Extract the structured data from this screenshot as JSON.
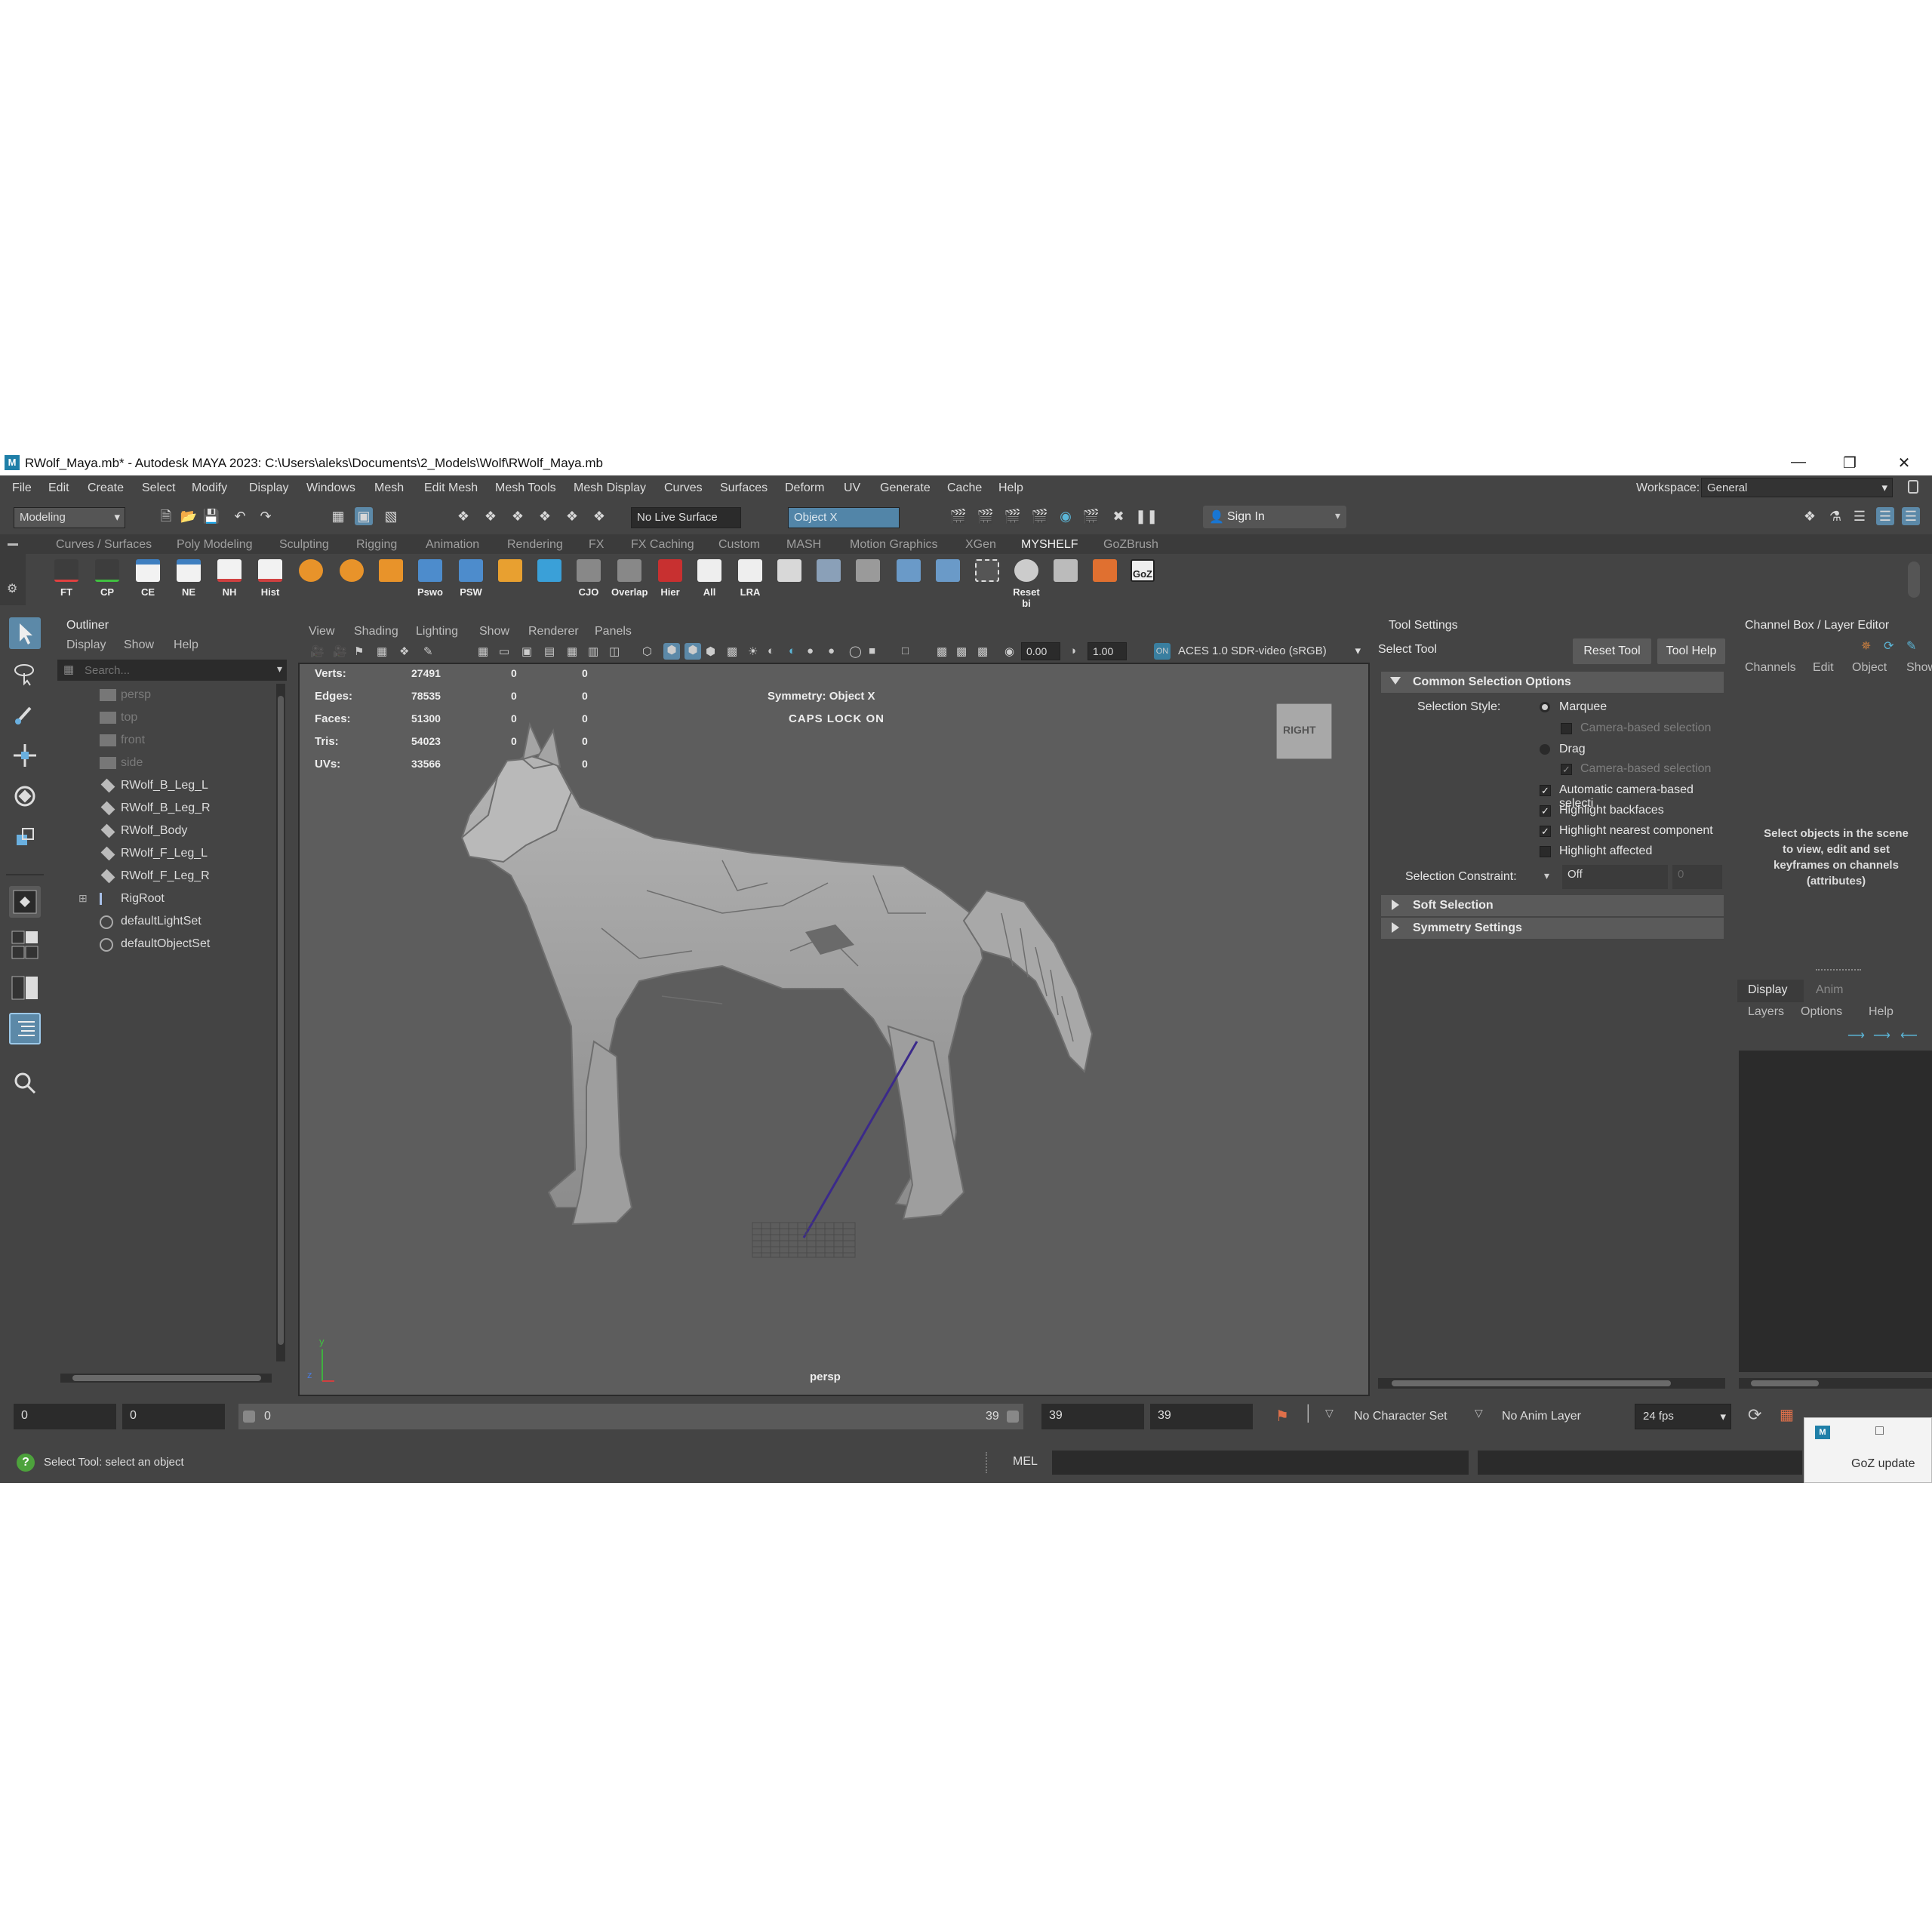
{
  "titlebar": {
    "title": "RWolf_Maya.mb* - Autodesk MAYA 2023: C:\\Users\\aleks\\Documents\\2_Models\\Wolf\\RWolf_Maya.mb",
    "app_icon": "M"
  },
  "menubar": {
    "items": [
      "File",
      "Edit",
      "Create",
      "Select",
      "Modify",
      "Display",
      "Windows",
      "Mesh",
      "Edit Mesh",
      "Mesh Tools",
      "Mesh Display",
      "Curves",
      "Surfaces",
      "Deform",
      "UV",
      "Generate",
      "Cache",
      "Help"
    ],
    "workspace_label": "Workspace:",
    "workspace_value": "General"
  },
  "statusline": {
    "menuset": "Modeling",
    "live_surface": "No Live Surface",
    "symmetry": "Object X",
    "sign_in": "Sign In"
  },
  "shelf": {
    "tabs": [
      "Curves / Surfaces",
      "Poly Modeling",
      "Sculpting",
      "Rigging",
      "Animation",
      "Rendering",
      "FX",
      "FX Caching",
      "Custom",
      "MASH",
      "Motion Graphics",
      "XGen",
      "MYSHELF",
      "GoZBrush"
    ],
    "active_tab": "MYSHELF",
    "buttons": [
      "FT",
      "CP",
      "CE",
      "NE",
      "NH",
      "Hist",
      "",
      "",
      "",
      "Pswo",
      "PSW",
      "",
      "",
      "CJO",
      "Overlap",
      "Hier",
      "All",
      "LRA",
      "",
      "",
      "",
      "",
      "",
      "",
      "",
      "Reset bi",
      "",
      "",
      "GoZ"
    ]
  },
  "outliner": {
    "title": "Outliner",
    "menus": [
      "Display",
      "Show",
      "Help"
    ],
    "search_placeholder": "Search...",
    "items": [
      {
        "name": "persp",
        "dim": true
      },
      {
        "name": "top",
        "dim": true
      },
      {
        "name": "front",
        "dim": true
      },
      {
        "name": "side",
        "dim": true
      },
      {
        "name": "RWolf_B_Leg_L",
        "dim": false
      },
      {
        "name": "RWolf_B_Leg_R",
        "dim": false
      },
      {
        "name": "RWolf_Body",
        "dim": false
      },
      {
        "name": "RWolf_F_Leg_L",
        "dim": false
      },
      {
        "name": "RWolf_F_Leg_R",
        "dim": false
      },
      {
        "name": "RigRoot",
        "dim": false
      },
      {
        "name": "defaultLightSet",
        "dim": false
      },
      {
        "name": "defaultObjectSet",
        "dim": false
      }
    ]
  },
  "viewport": {
    "menus": [
      "View",
      "Shading",
      "Lighting",
      "Show",
      "Renderer",
      "Panels"
    ],
    "exposure": "0.00",
    "gamma": "1.00",
    "colorspace": "ACES 1.0 SDR-video (sRGB)",
    "stats": [
      {
        "label": "Verts:",
        "a": "27491",
        "b": "0",
        "c": "0"
      },
      {
        "label": "Edges:",
        "a": "78535",
        "b": "0",
        "c": "0"
      },
      {
        "label": "Faces:",
        "a": "51300",
        "b": "0",
        "c": "0"
      },
      {
        "label": "Tris:",
        "a": "54023",
        "b": "0",
        "c": "0"
      },
      {
        "label": "UVs:",
        "a": "33566",
        "b": "0",
        "c": "0"
      }
    ],
    "symmetry_hud": "Symmetry: Object X",
    "caps_hud": "CAPS LOCK ON",
    "viewcube": "RIGHT",
    "camera": "persp"
  },
  "tool_settings": {
    "title": "Tool Settings",
    "tool_name": "Select Tool",
    "reset_btn": "Reset Tool",
    "help_btn": "Tool Help",
    "section_common": "Common Selection Options",
    "selection_style_label": "Selection Style:",
    "marquee": "Marquee",
    "camera_based": "Camera-based selection",
    "drag": "Drag",
    "camera_based2": "Camera-based selection",
    "auto_camera": "Automatic camera-based selecti",
    "highlight_backfaces": "Highlight backfaces",
    "highlight_nearest": "Highlight nearest component",
    "highlight_affected": "Highlight affected",
    "constraint_label": "Selection Constraint:",
    "constraint_value": "Off",
    "constraint_num": "0",
    "soft_selection": "Soft Selection",
    "symmetry_settings": "Symmetry Settings"
  },
  "channel_box": {
    "title": "Channel Box / Layer Editor",
    "menus": [
      "Channels",
      "Edit",
      "Object",
      "Show"
    ],
    "message": "Select objects in the scene to view, edit and set keyframes on channels (attributes)",
    "tabs": [
      "Display",
      "Anim"
    ],
    "layer_menus": [
      "Layers",
      "Options",
      "Help"
    ]
  },
  "timeline": {
    "start": "0",
    "range_start": "0",
    "slider_start": "0",
    "slider_end": "39",
    "range_end": "39",
    "end": "39",
    "character_set": "No Character Set",
    "anim_layer": "No Anim Layer",
    "fps": "24 fps"
  },
  "statusbar": {
    "help_text": "Select Tool: select an object",
    "mel_label": "MEL",
    "goz_update": "GoZ update"
  }
}
